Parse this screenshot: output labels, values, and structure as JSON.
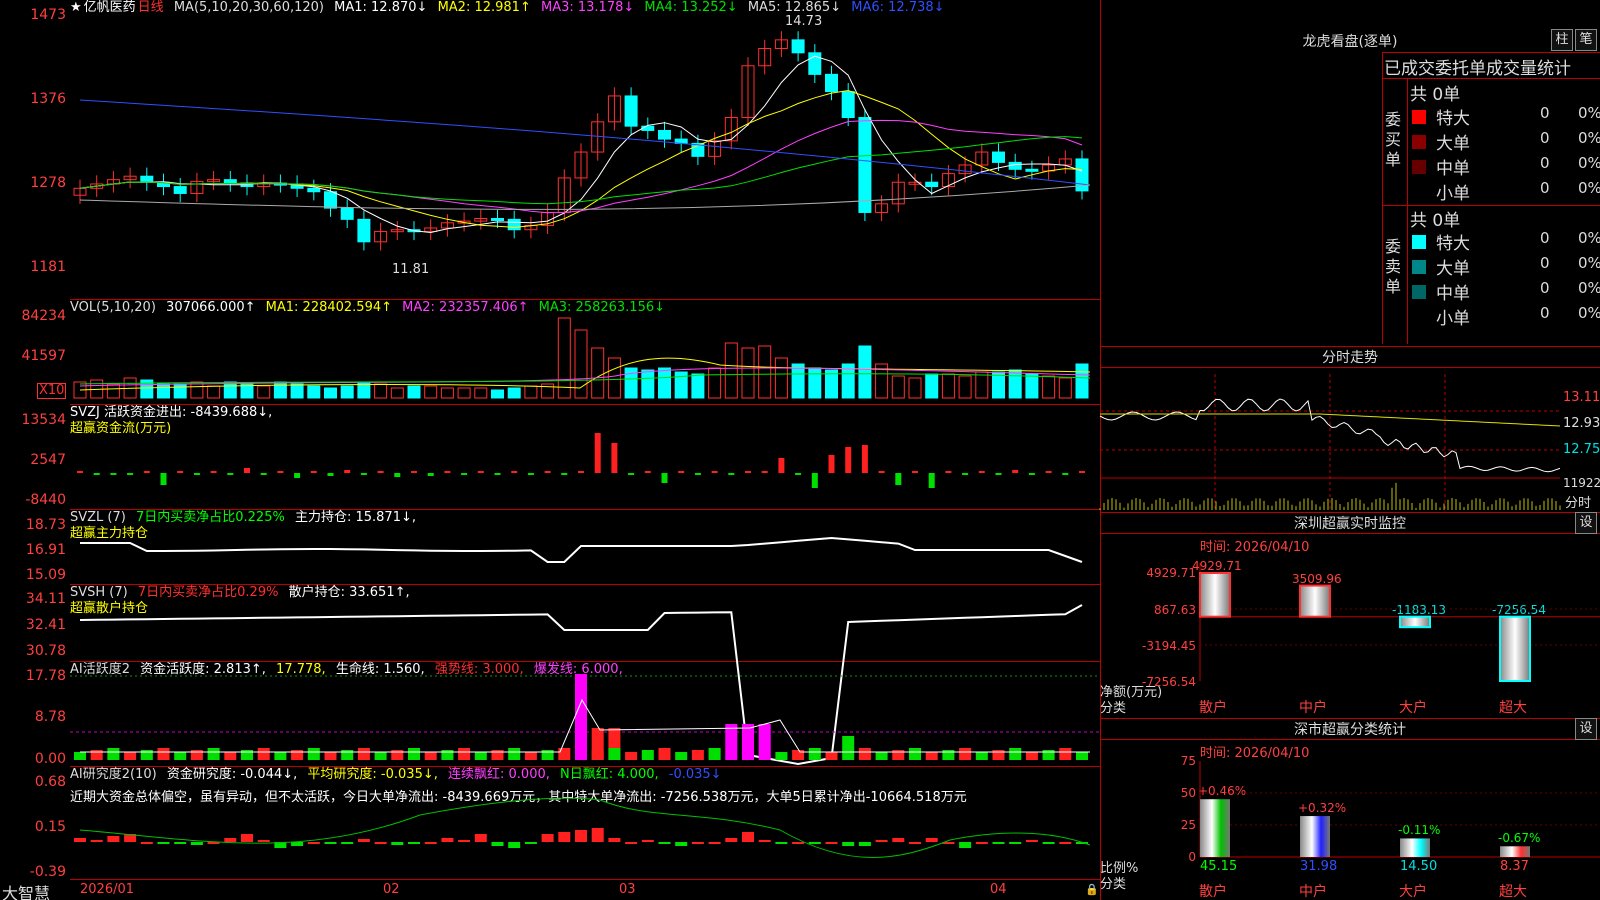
{
  "stock_name": "亿帆医药",
  "period": "日线",
  "header": {
    "ma_label": "MA(5,10,20,30,60,120)",
    "ma1": "MA1: 12.870↓",
    "ma2": "MA2: 12.981↑",
    "ma3": "MA3: 13.178↓",
    "ma4": "MA4: 13.252↓",
    "ma5": "MA5: 12.865↓",
    "ma6": "MA6: 12.738↓",
    "vol_label": "VOL(5,10,20)",
    "vol_val": "307066.000↑",
    "vma1": "MA1: 228402.594↑",
    "vma2": "MA2: 232357.406↑",
    "vma3": "MA3: 258263.156↓",
    "svzj_a": "SVZJ  活跃资金进出: -8439.688↓,",
    "svzj_b": "超赢资金流(万元)",
    "svzl_a": "SVZL (7)",
    "svzl_b": "7日内买卖净占比0.225%",
    "svzl_c": "主力持仓: 15.871↓,",
    "svzl_d": "超赢主力持仓",
    "svsh_a": "SVSH (7)",
    "svsh_b": "7日内买卖净占比0.29%",
    "svsh_c": "散户持仓: 33.651↑,",
    "svsh_d": "超赢散户持仓",
    "ai1_a": "AI活跃度2",
    "ai1_b": "资金活跃度: 2.813↑,",
    "ai1_c": "17.778,",
    "ai1_d": "生命线: 1.560,",
    "ai1_e": "强势线: 3.000,",
    "ai1_f": "爆发线: 6.000,",
    "ai2_a": "AI研究度2(10)",
    "ai2_b": "资金研究度: -0.044↓,",
    "ai2_c": "平均研究度: -0.035↓,",
    "ai2_d": "连续飘红: 0.000,",
    "ai2_e": "N日飘红: 4.000,",
    "ai2_f": "-0.035↓",
    "ai2_text": "近期大资金总体偏空，虽有异动，但不太活跃，今日大单净流出: -8439.669万元，其中特大单净流出: -7256.538万元，大单5日累计净出-10664.518万元"
  },
  "yaxis": {
    "price": [
      "1473",
      "1376",
      "1278",
      "1181"
    ],
    "vol": [
      "84234",
      "41597",
      "X10"
    ],
    "svzj": [
      "13534",
      "2547",
      "-8440"
    ],
    "svzl": [
      "18.73",
      "16.91",
      "15.09"
    ],
    "svsh": [
      "34.11",
      "32.41",
      "30.78"
    ],
    "ai1": [
      "17.78",
      "8.78",
      "0.00"
    ],
    "ai2": [
      "0.68",
      "0.15",
      "-0.39"
    ]
  },
  "price_high_label": "14.73",
  "price_low_label": "11.81",
  "dates": [
    "2026/01",
    "02",
    "03",
    "04"
  ],
  "brand": "大智慧",
  "right": {
    "lhb_title": "龙虎看盘(逐单)",
    "btn_bar": "柱",
    "btn_pen": "笔",
    "tabs_label": "已成交委托单成交量统计",
    "buy": {
      "label": "委买单",
      "total": "共 0单",
      "rows": [
        {
          "name": "特大",
          "count": "0",
          "pct": "0%",
          "color": "#ff0000"
        },
        {
          "name": "大单",
          "count": "0",
          "pct": "0%",
          "color": "#880000"
        },
        {
          "name": "中单",
          "count": "0",
          "pct": "0%",
          "color": "#660000"
        },
        {
          "name": "小单",
          "count": "0",
          "pct": "0%",
          "color": ""
        }
      ]
    },
    "sell": {
      "label": "委卖单",
      "total": "共 0单",
      "rows": [
        {
          "name": "特大",
          "count": "0",
          "pct": "0%",
          "color": "#00ffff"
        },
        {
          "name": "大单",
          "count": "0",
          "pct": "0%",
          "color": "#008888"
        },
        {
          "name": "中单",
          "count": "0",
          "pct": "0%",
          "color": "#006666"
        },
        {
          "name": "小单",
          "count": "0",
          "pct": "0%",
          "color": ""
        }
      ]
    },
    "fs_title": "分时走势",
    "fs_y": [
      "13.11",
      "12.93",
      "12.75",
      "11922"
    ],
    "fs_tag": "分时",
    "sz_title": "深圳超赢实时监控",
    "sz_time": "时间: 2026/04/10",
    "set_label": "设",
    "sz_y": [
      "4929.71",
      "867.63",
      "-3194.45",
      "-7256.54"
    ],
    "sz_unit": "净额(万元)",
    "sz_cat_label": "分类",
    "cats": [
      "散户",
      "中户",
      "大户",
      "超大"
    ],
    "sz_vals": [
      "4929.71",
      "3509.96",
      "-1183.13",
      "-7256.54"
    ],
    "ss_title": "深市超赢分类统计",
    "ss_time": "时间: 2026/04/10",
    "ss_y": [
      "75",
      "50",
      "25",
      "0"
    ],
    "ss_unit": "比例%",
    "ss_cat_label": "分类",
    "ss_top": [
      "+0.46%",
      "+0.32%",
      "-0.11%",
      "-0.67%"
    ],
    "ss_vals": [
      "45.15",
      "31.98",
      "14.50",
      "8.37"
    ]
  },
  "chart_data": [
    {
      "type": "bar",
      "title": "深圳超赢实时监控",
      "categories": [
        "散户",
        "中户",
        "大户",
        "超大"
      ],
      "values": [
        4929.71,
        3509.96,
        -1183.13,
        -7256.54
      ],
      "ylabel": "净额(万元)",
      "ylim": [
        -7256.54,
        4929.71
      ]
    },
    {
      "type": "bar",
      "title": "深市超赢分类统计",
      "categories": [
        "散户",
        "中户",
        "大户",
        "超大"
      ],
      "values": [
        45.15,
        31.98,
        14.5,
        8.37
      ],
      "ylabel": "比例%",
      "ylim": [
        0,
        75
      ]
    }
  ]
}
